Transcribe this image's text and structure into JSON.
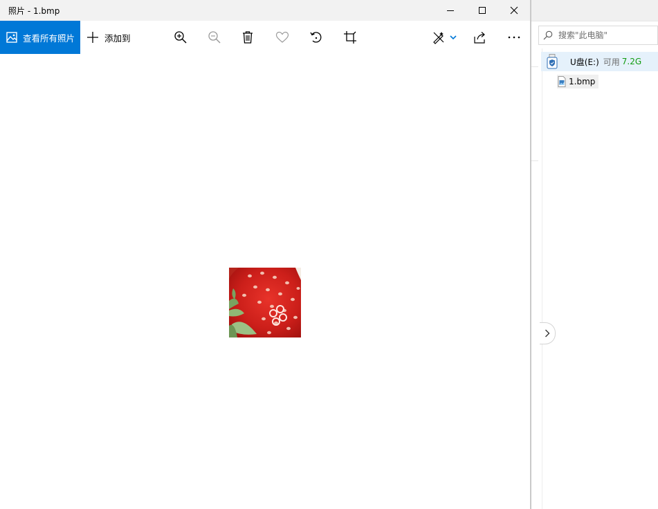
{
  "photos": {
    "title": "照片 - 1.bmp",
    "toolbar": {
      "view_all_label": "查看所有照片",
      "add_label": "添加到"
    },
    "window_buttons": [
      "minimize-icon",
      "maximize-icon",
      "close-icon"
    ],
    "toolbar_icons": [
      "zoom-in-icon",
      "zoom-out-icon",
      "delete-icon",
      "favorite-heart-icon",
      "rotate-icon",
      "crop-icon",
      "edit-draw-icon",
      "share-icon",
      "more-icon"
    ],
    "image": {
      "subject": "strawberry close-up"
    }
  },
  "explorer": {
    "search": {
      "placeholder": "搜索\"此电脑\""
    },
    "drive": {
      "name": "U盘(E:)",
      "available_label": "可用",
      "available_size": "7.2G"
    },
    "file": {
      "name": "1.bmp"
    }
  },
  "colors": {
    "accent": "#0078d7",
    "free_space_green": "#119c11",
    "selected_row": "#e5f1fb"
  }
}
